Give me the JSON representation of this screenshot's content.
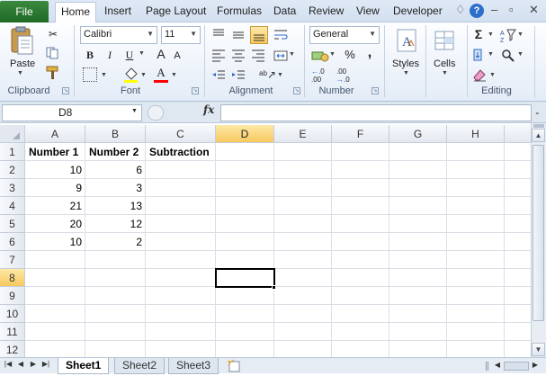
{
  "menu": {
    "file": "File",
    "tabs": [
      "Home",
      "Insert",
      "Page Layout",
      "Formulas",
      "Data",
      "Review",
      "View",
      "Developer"
    ],
    "active_tab": "Home",
    "help": "?"
  },
  "ribbon": {
    "clipboard": {
      "label": "Clipboard",
      "paste": "Paste"
    },
    "font": {
      "label": "Font",
      "name": "Calibri",
      "size": "11",
      "bold": "B",
      "italic": "I",
      "underline": "U",
      "grow": "A",
      "shrink": "A",
      "fill_color": "#ffff00",
      "font_color": "#ff0000"
    },
    "alignment": {
      "label": "Alignment"
    },
    "number": {
      "label": "Number",
      "format": "General",
      "currency": "$",
      "percent": "%",
      "comma": ",",
      "inc_decimal": ".0 .00",
      "dec_decimal": ".00 .0"
    },
    "styles": {
      "label": "Styles"
    },
    "cells": {
      "label": "Cells"
    },
    "editing": {
      "label": "Editing",
      "sum": "Σ"
    }
  },
  "formula_bar": {
    "name_box": "D8",
    "fx": "fx",
    "formula": ""
  },
  "sheet": {
    "columns": [
      "A",
      "B",
      "C",
      "D",
      "E",
      "F",
      "G",
      "H"
    ],
    "selected_column": "D",
    "rows": [
      "1",
      "2",
      "3",
      "4",
      "5",
      "6",
      "7",
      "8",
      "9",
      "10",
      "11",
      "12"
    ],
    "selected_row": "8",
    "headers": [
      "Number 1",
      "Number 2",
      "Subtraction"
    ],
    "data": [
      [
        "10",
        "6"
      ],
      [
        "9",
        "3"
      ],
      [
        "21",
        "13"
      ],
      [
        "20",
        "12"
      ],
      [
        "10",
        "2"
      ]
    ]
  },
  "sheet_tabs": [
    "Sheet1",
    "Sheet2",
    "Sheet3"
  ],
  "active_sheet": "Sheet1"
}
